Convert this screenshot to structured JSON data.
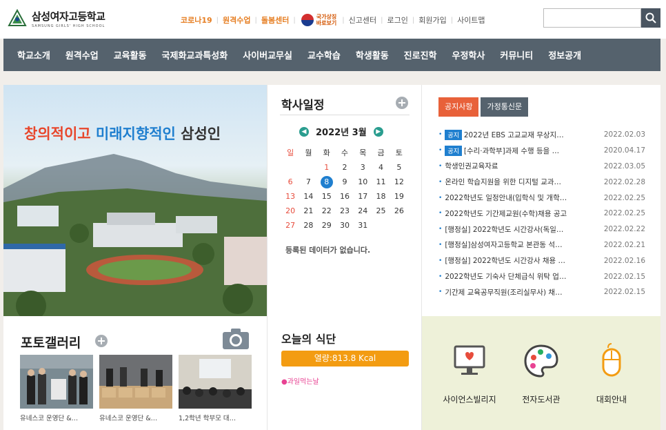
{
  "header": {
    "logo_text": "삼성여자고등학교",
    "logo_sub": "SAMSUNG GIRLS' HIGH SCHOOL",
    "links": {
      "corona": "코로나19",
      "remote": "원격수업",
      "care": "돌봄센터",
      "flag_line1": "국가상징",
      "flag_line2": "바로보기",
      "report": "신고센터",
      "login": "로그인",
      "join": "회원가입",
      "sitemap": "사이트맵"
    },
    "search_placeholder": ""
  },
  "nav": {
    "items": [
      "학교소개",
      "원격수업",
      "교육활동",
      "국제화교과특성화",
      "사이버교무실",
      "교수학습",
      "학생활동",
      "진로진학",
      "우정학사",
      "커뮤니티",
      "정보공개"
    ]
  },
  "hero": {
    "part1": "창의적이고",
    "part2": "미래지향적인",
    "part3": "삼성인"
  },
  "schedule": {
    "title": "학사일정",
    "month": "2022년 3월",
    "weekdays": [
      "일",
      "월",
      "화",
      "수",
      "목",
      "금",
      "토"
    ],
    "weeks": [
      [
        "",
        "",
        "1",
        "2",
        "3",
        "4",
        "5"
      ],
      [
        "6",
        "7",
        "8",
        "9",
        "10",
        "11",
        "12"
      ],
      [
        "13",
        "14",
        "15",
        "16",
        "17",
        "18",
        "19"
      ],
      [
        "20",
        "21",
        "22",
        "23",
        "24",
        "25",
        "26"
      ],
      [
        "27",
        "28",
        "29",
        "30",
        "31",
        "",
        ""
      ]
    ],
    "red_dates": [
      "1"
    ],
    "today": "8",
    "no_data": "등록된 데이터가 없습니다."
  },
  "notice": {
    "tab_active": "공지사항",
    "tab_other": "가정통신문",
    "badge": "공지",
    "items": [
      {
        "badge": true,
        "title": "2022년 EBS 고교교재 무상지…",
        "date": "2022.02.03"
      },
      {
        "badge": true,
        "title": "[수리·과학부]과제 수행 등을 …",
        "date": "2020.04.17"
      },
      {
        "badge": false,
        "title": "학생인권교육자료",
        "date": "2022.03.05"
      },
      {
        "badge": false,
        "title": "온라인 학습지원을 위한 디지털 교과…",
        "date": "2022.02.28"
      },
      {
        "badge": false,
        "title": "2022학년도 일정안내(입학식 및 개학…",
        "date": "2022.02.25"
      },
      {
        "badge": false,
        "title": "2022학년도 기간제교원(수학)채용 공고",
        "date": "2022.02.25"
      },
      {
        "badge": false,
        "title": "[행정실] 2022학년도 시간강사(독일…",
        "date": "2022.02.22"
      },
      {
        "badge": false,
        "title": "[행정실]삼성여자고등학교 본관동 석…",
        "date": "2022.02.21"
      },
      {
        "badge": false,
        "title": "[행정실] 2022학년도 시간강사 채용 …",
        "date": "2022.02.16"
      },
      {
        "badge": false,
        "title": "2022학년도 기숙사 단체급식 위탁 업…",
        "date": "2022.02.15"
      },
      {
        "badge": false,
        "title": "기간제 교육공무직원(조리실무사) 채…",
        "date": "2022.02.15"
      }
    ]
  },
  "gallery": {
    "title": "포토갤러리",
    "items": [
      {
        "caption": "유네스코 운영단 &…"
      },
      {
        "caption": "유네스코 운영단 &…"
      },
      {
        "caption": "1,2학년 학부모 대…"
      }
    ]
  },
  "meal": {
    "title": "오늘의 식단",
    "kcal": "열량:813.8 Kcal",
    "item": "●과일먹는날"
  },
  "quick": {
    "items": [
      {
        "label": "사이언스빌리지"
      },
      {
        "label": "전자도서관"
      },
      {
        "label": "대회안내"
      }
    ]
  },
  "colors": {
    "nav_bg": "#55626d",
    "accent_orange": "#e67e22",
    "tab_active": "#e8613a",
    "notice_blue": "#1f7fcf",
    "meal_orange": "#f39c12",
    "quick_bg": "#eef1d9"
  }
}
